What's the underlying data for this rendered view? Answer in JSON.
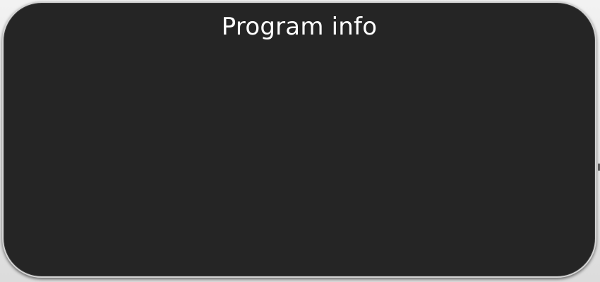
{
  "dialog": {
    "title": "Program info"
  },
  "colors": {
    "panel_background": "#252525",
    "panel_border": "#d4d4d4",
    "title_text": "#ffffff",
    "page_background": "#e8e8e8"
  }
}
